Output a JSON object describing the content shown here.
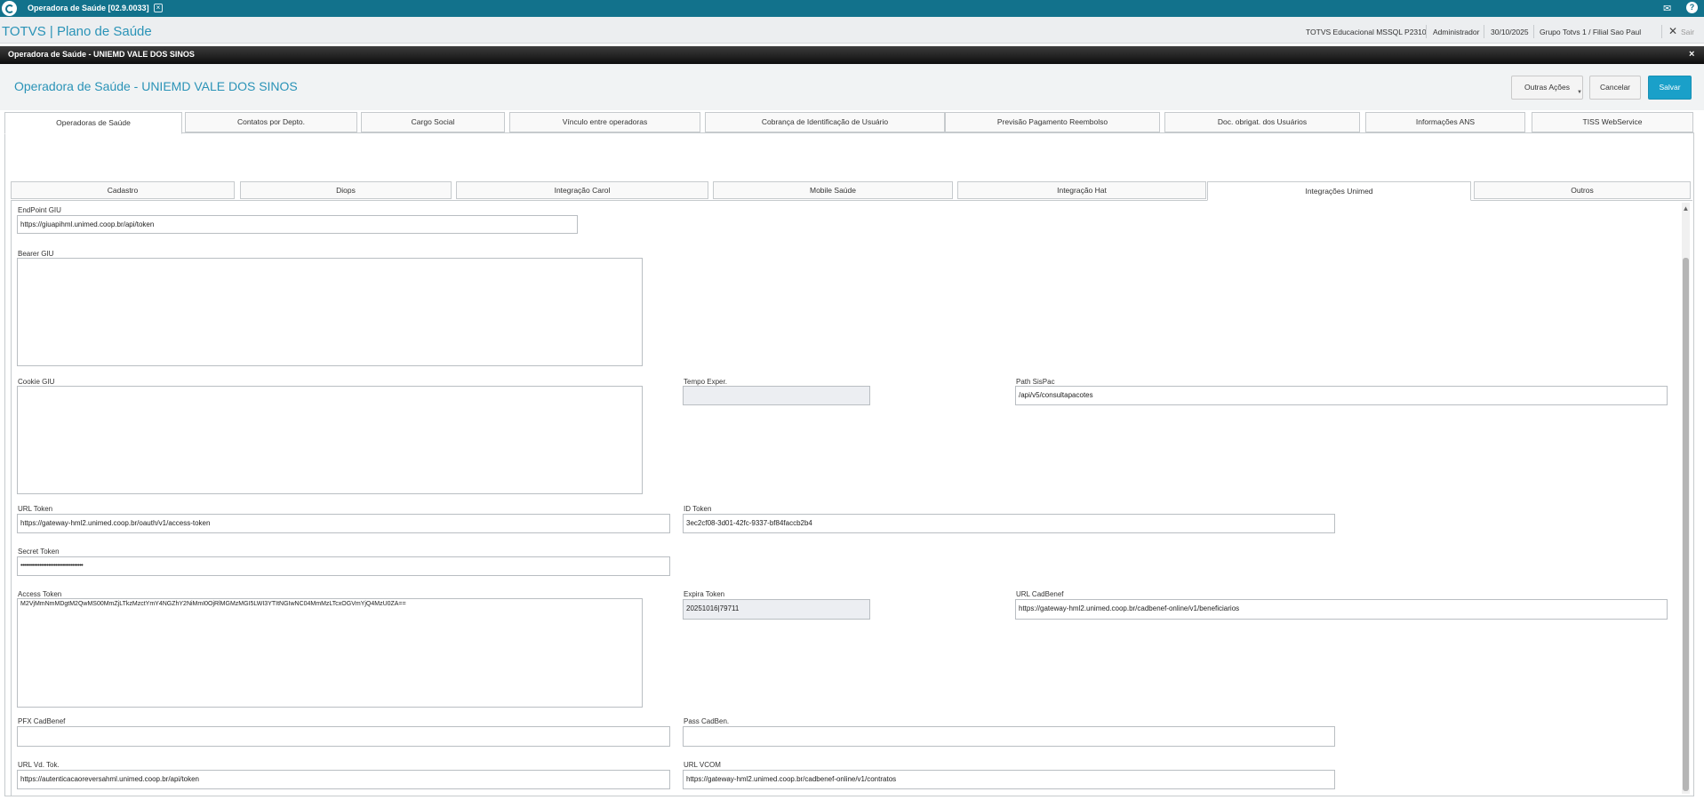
{
  "topbar": {
    "app_tab": "Operadora de Saúde [02.9.0033]",
    "close_glyph": "×",
    "mail_glyph": "✉",
    "help_glyph": "?"
  },
  "header": {
    "brand": "TOTVS | Plano de Saúde",
    "environment": "TOTVS Educacional MSSQL P2310",
    "user": "Administrador",
    "date": "30/10/2025",
    "branch": "Grupo Totvs 1 / Filial Sao Paul",
    "logout_glyph": "✕",
    "logout": "Sair"
  },
  "dialog": {
    "titlebar": "Operadora de Saúde - UNIEMD VALE DOS SINOS",
    "close_glyph": "×",
    "title": "Operadora de Saúde - UNIEMD VALE DOS SINOS",
    "buttons": {
      "outras_acoes": "Outras Ações",
      "cancelar": "Cancelar",
      "salvar": "Salvar"
    }
  },
  "main_tabs": [
    {
      "label": "Operadoras de Saúde",
      "active": true
    },
    {
      "label": "Contatos por Depto."
    },
    {
      "label": "Cargo Social"
    },
    {
      "label": "Vínculo entre operadoras"
    },
    {
      "label": "Cobrança de Identificação de Usuário"
    },
    {
      "label": "Previsão Pagamento Reembolso"
    },
    {
      "label": "Doc. obrigat. dos Usuários"
    },
    {
      "label": "Informações ANS"
    },
    {
      "label": "TISS WebService"
    }
  ],
  "sub_tabs": [
    {
      "label": "Cadastro"
    },
    {
      "label": "Diops"
    },
    {
      "label": "Integração Carol"
    },
    {
      "label": "Mobile Saúde"
    },
    {
      "label": "Integração Hat"
    },
    {
      "label": "Integrações Unimed",
      "active": true
    },
    {
      "label": "Outros"
    }
  ],
  "form": {
    "endpoint_giu": {
      "label": "EndPoint GIU",
      "value": "https://giuapihml.unimed.coop.br/api/token"
    },
    "bearer_giu": {
      "label": "Bearer GIU",
      "value": ""
    },
    "cookie_giu": {
      "label": "Cookie GIU",
      "value": ""
    },
    "tempo_exper": {
      "label": "Tempo Exper.",
      "value": ""
    },
    "path_sispac": {
      "label": "Path SisPac",
      "value": "/api/v5/consultapacotes"
    },
    "url_token": {
      "label": "URL Token",
      "value": "https://gateway-hml2.unimed.coop.br/oauth/v1/access-token"
    },
    "id_token": {
      "label": "ID Token",
      "value": "3ec2cf08-3d01-42fc-9337-bf84faccb2b4"
    },
    "secret_token": {
      "label": "Secret Token",
      "value": "••••••••••••••••••••••••••••••••••••"
    },
    "access_token": {
      "label": "Access Token",
      "value": "M2VjMmNmMDgtM2QwMS00MmZjLTkzMzctYmY4NGZhY2NiMmI0OjRlMGMzMGI5LWI3YTItNGIwNC04MmMzLTcxOGVmYjQ4MzU0ZA=="
    },
    "expira_token": {
      "label": "Expira Token",
      "value": "20251016|79711"
    },
    "url_cadbenef": {
      "label": "URL CadBenef",
      "value": "https://gateway-hml2.unimed.coop.br/cadbenef-online/v1/beneficiarios"
    },
    "pfx_cadbenef": {
      "label": "PFX CadBenef",
      "value": ""
    },
    "pass_cadben": {
      "label": "Pass CadBen.",
      "value": ""
    },
    "url_vd_tok": {
      "label": "URL Vd. Tok.",
      "value": "https://autenticacaoreversahml.unimed.coop.br/api/token"
    },
    "url_vcom": {
      "label": "URL VCOM",
      "value": "https://gateway-hml2.unimed.coop.br/cadbenef-online/v1/contratos"
    }
  },
  "colors": {
    "topbar": "#12728c",
    "accent": "#2a93b7",
    "save_button": "#1aa0c9"
  }
}
